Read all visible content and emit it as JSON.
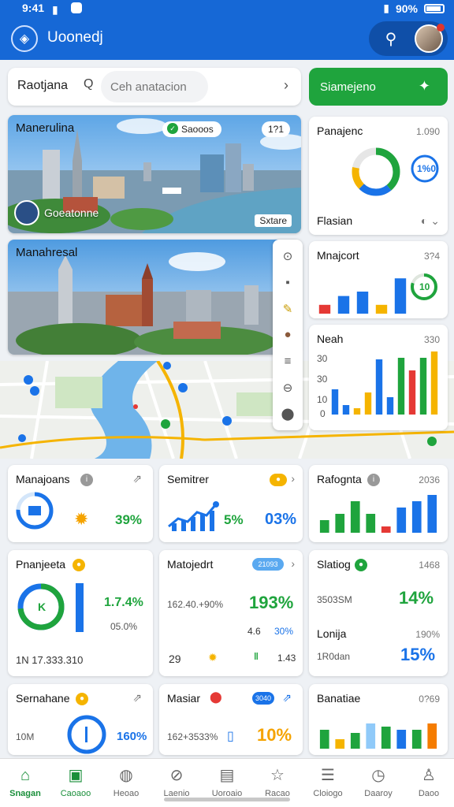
{
  "status_bar": {
    "time": "9:41",
    "battery": "90%"
  },
  "app": {
    "title": "Uoonedj"
  },
  "search": {
    "label": "Raotjana",
    "placeholder": "Ceh anatacion",
    "button_label": "Siamejeno"
  },
  "photo_cards": [
    {
      "title": "Manerulina",
      "badge": "Saooos",
      "count": "1?1",
      "location": "Goeatonne",
      "tag": "Sxtare"
    },
    {
      "title": "Manahresal"
    }
  ],
  "donut_card": {
    "title": "Panajenc",
    "meta": "1.090",
    "ring_value": "1%0",
    "subtitle": "Flasian",
    "ring_fraction": 0.78,
    "ring_colors": [
      "#1fa43d",
      "#1a73e8",
      "#f5b400"
    ]
  },
  "bar_card_1": {
    "title": "Mnajcort",
    "meta": "3?4",
    "ring_value": "10",
    "ring_fraction": 0.8,
    "chart_data": {
      "type": "bar",
      "values": [
        2,
        4,
        5,
        2,
        8
      ],
      "colors": [
        "#e53935",
        "#1a73e8",
        "#1a73e8",
        "#f5b400",
        "#1a73e8"
      ],
      "ylim": [
        0,
        10
      ],
      "categories": [
        "",
        "",
        "",
        "",
        ""
      ]
    }
  },
  "bar_card_2": {
    "title": "Neah",
    "meta": "330",
    "y_ticks": [
      "30",
      "30",
      "10",
      "0"
    ],
    "chart_data": {
      "type": "bar",
      "values": [
        16,
        6,
        4,
        14,
        35,
        11,
        36,
        28,
        36,
        40
      ],
      "colors": [
        "#1a73e8",
        "#1a73e8",
        "#f5b400",
        "#f5b400",
        "#1a73e8",
        "#1a73e8",
        "#1fa43d",
        "#e53935",
        "#1fa43d",
        "#f5b400"
      ],
      "ylim": [
        0,
        40
      ]
    }
  },
  "tiles": [
    {
      "title": "Manajoans",
      "meta": "",
      "value": "39%",
      "secondary": ""
    },
    {
      "title": "Semitrer",
      "meta": "",
      "value": "5%",
      "secondary": "03%"
    },
    {
      "title": "Rafognta",
      "meta": "2036"
    },
    {
      "title": "Pnanjeeta",
      "value": "1.7.4%",
      "secondary": "05.0%",
      "footer": "1N 17.333.310",
      "ring_value": "K"
    },
    {
      "title": "Matojedrt",
      "meta": "21093",
      "value": "193%",
      "secondary": "162.40.+90%",
      "sub_a": "4.6",
      "sub_b": "29",
      "sub_c": "1.43",
      "sub_d": "30%"
    },
    {
      "title": "Slatiog",
      "meta": "1468",
      "value": "14%",
      "secondary": "3503SM",
      "sub_title": "Lonija",
      "sub_meta": "190%",
      "sub_value": "15%",
      "sub_text": "1R0dan"
    },
    {
      "title": "Sernahane",
      "value": "160%",
      "secondary": "10M"
    },
    {
      "title": "Masiar",
      "meta": "3040",
      "value": "10%",
      "secondary": "162+3533%"
    },
    {
      "title": "Banatiae",
      "meta": "0?69"
    }
  ],
  "rafognta_chart": {
    "type": "bar",
    "values": [
      2,
      3,
      5,
      3,
      1,
      4,
      5,
      6
    ],
    "colors": [
      "#1fa43d",
      "#1fa43d",
      "#1fa43d",
      "#1fa43d",
      "#e53935",
      "#1a73e8",
      "#1a73e8",
      "#1a73e8"
    ],
    "ylim": [
      0,
      6
    ]
  },
  "banatiae_chart": {
    "type": "bar",
    "values": [
      6,
      3,
      5,
      8,
      7,
      6,
      6,
      8
    ],
    "colors": [
      "#1fa43d",
      "#f5b400",
      "#1fa43d",
      "#90caf9",
      "#1fa43d",
      "#1a73e8",
      "#1fa43d",
      "#f57c00"
    ],
    "ylim": [
      0,
      10
    ]
  },
  "bottom_nav": [
    {
      "label": "Snagan",
      "icon": "home-icon",
      "active": true
    },
    {
      "label": "Caoaoo",
      "icon": "board-icon",
      "active": false
    },
    {
      "label": "Heoao",
      "icon": "globe-icon",
      "active": false
    },
    {
      "label": "Laenio",
      "icon": "compass-icon",
      "active": false
    },
    {
      "label": "Uoroaio",
      "icon": "doc-icon",
      "active": false
    },
    {
      "label": "Racao",
      "icon": "star-icon",
      "active": false
    },
    {
      "label": "Cloiogo",
      "icon": "list-icon",
      "active": false
    },
    {
      "label": "Daaroy",
      "icon": "clock-icon",
      "active": false
    },
    {
      "label": "Daoo",
      "icon": "user-icon",
      "active": false
    }
  ],
  "colors": {
    "primary": "#1668d6",
    "accent_green": "#1fa43d",
    "red": "#e53935",
    "amber": "#f5b400"
  }
}
